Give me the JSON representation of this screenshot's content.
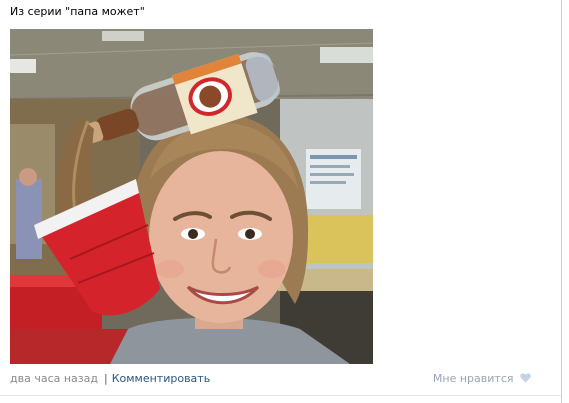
{
  "post": {
    "text": "Из серии \"папа может\"",
    "photo_icon": "photo-girl-with-soda-bottle-hair"
  },
  "footer": {
    "time": "два часа назад",
    "separator": "|",
    "comment_label": "Комментировать"
  },
  "like": {
    "label": "Мне нравится",
    "icon": "heart-icon"
  },
  "colors": {
    "link": "#2b587a",
    "muted_text": "#8a8a8a",
    "like_text": "#98a5b2",
    "heart": "#c5d3e2"
  }
}
